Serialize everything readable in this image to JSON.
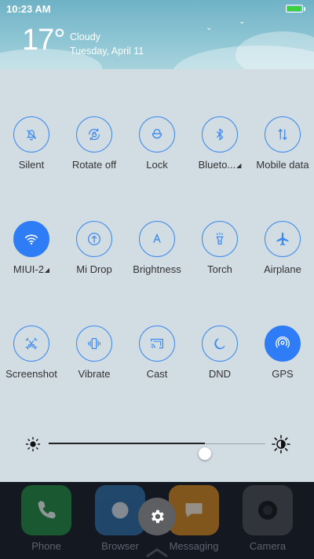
{
  "status": {
    "time": "10:23 AM",
    "battery_level": 0.95,
    "battery_color": "#39d239"
  },
  "weather": {
    "temperature": "17°",
    "condition": "Cloudy",
    "date": "Tuesday, April 11"
  },
  "toggles": [
    {
      "label": "Silent",
      "icon": "bell-off-icon",
      "active": false
    },
    {
      "label": "Rotate off",
      "icon": "rotate-lock-icon",
      "active": false
    },
    {
      "label": "Lock",
      "icon": "lock-icon",
      "active": false
    },
    {
      "label": "Blueto...",
      "icon": "bluetooth-icon",
      "active": false,
      "has_menu": true
    },
    {
      "label": "Mobile data",
      "icon": "mobile-data-icon",
      "active": false
    },
    {
      "label": "MIUI-2",
      "icon": "wifi-icon",
      "active": true,
      "has_menu": true
    },
    {
      "label": "Mi Drop",
      "icon": "mi-drop-icon",
      "active": false
    },
    {
      "label": "Brightness",
      "icon": "brightness-a-icon",
      "active": false
    },
    {
      "label": "Torch",
      "icon": "torch-icon",
      "active": false
    },
    {
      "label": "Airplane",
      "icon": "airplane-icon",
      "active": false
    },
    {
      "label": "Screenshot",
      "icon": "screenshot-icon",
      "active": false
    },
    {
      "label": "Vibrate",
      "icon": "vibrate-icon",
      "active": false
    },
    {
      "label": "Cast",
      "icon": "cast-icon",
      "active": false
    },
    {
      "label": "DND",
      "icon": "moon-icon",
      "active": false
    },
    {
      "label": "GPS",
      "icon": "gps-icon",
      "active": true
    }
  ],
  "brightness": {
    "level": 0.72
  },
  "dock": [
    {
      "label": "Phone",
      "icon": "phone-icon",
      "color": "#1e8e3e"
    },
    {
      "label": "Browser",
      "icon": "browser-icon",
      "color": "#2b6fa8"
    },
    {
      "label": "Messaging",
      "icon": "messaging-icon",
      "color": "#d98a1c"
    },
    {
      "label": "Camera",
      "icon": "camera-icon",
      "color": "#4a4d52"
    }
  ],
  "colors": {
    "accent": "#2f7df6",
    "outline": "#3d8bef"
  }
}
